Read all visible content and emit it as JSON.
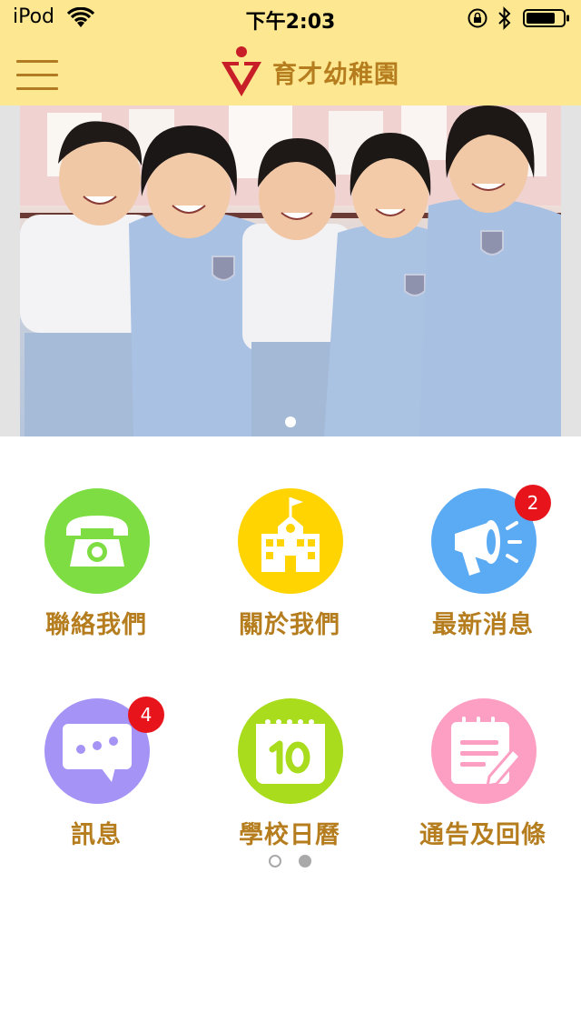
{
  "status_bar": {
    "carrier": "iPod",
    "time": "下午2:03"
  },
  "header": {
    "title": "育才幼稚園"
  },
  "banner": {
    "description": "Five kindergarten children in school uniforms smiling",
    "pages": 1,
    "current_page": 1
  },
  "grid": {
    "items": [
      {
        "label": "聯絡我們",
        "icon": "phone-icon",
        "color": "#7ddd42"
      },
      {
        "label": "關於我們",
        "icon": "school-icon",
        "color": "#ffd400"
      },
      {
        "label": "最新消息",
        "icon": "megaphone-icon",
        "color": "#5aabf4",
        "badge": "2"
      },
      {
        "label": "訊息",
        "icon": "chat-bubble-icon",
        "color": "#a593f5",
        "badge": "4"
      },
      {
        "label": "學校日曆",
        "icon": "calendar-icon",
        "color": "#a8dc1c"
      },
      {
        "label": "通告及回條",
        "icon": "notepad-icon",
        "color": "#fc9fc3"
      }
    ],
    "pager": {
      "total": 2,
      "current": 2
    }
  },
  "colors": {
    "bar_background": "#fde790",
    "title_text": "#b57d1e",
    "badge": "#e8141c"
  }
}
